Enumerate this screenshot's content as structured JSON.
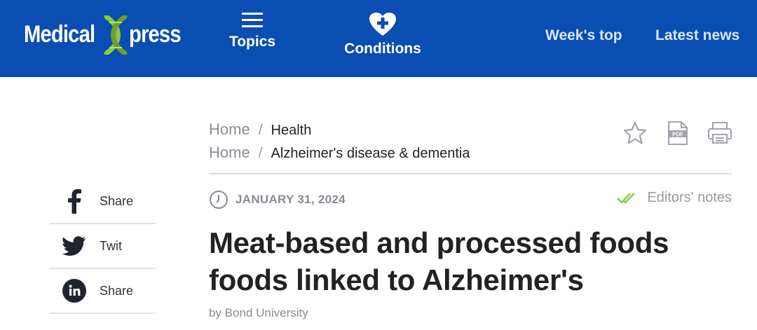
{
  "header": {
    "logo_left": "Medical",
    "logo_right": "press",
    "nav": {
      "topics_label": "Topics",
      "conditions_label": "Conditions",
      "weeks_top_label": "Week's top",
      "latest_news_label": "Latest news"
    },
    "colors": {
      "bar": "#0a4db3",
      "logo_accent": "#8dc63f"
    }
  },
  "breadcrumbs": [
    {
      "home": "Home",
      "separator": "/",
      "category": "Health"
    },
    {
      "home": "Home",
      "separator": "/",
      "category": "Alzheimer's disease & dementia"
    }
  ],
  "tools": {
    "favorite_icon": "star-icon",
    "pdf_icon": "pdf-icon",
    "print_icon": "printer-icon",
    "pdf_text": "PDF"
  },
  "share": [
    {
      "label": "Share",
      "icon": "facebook-icon"
    },
    {
      "label": "Twit",
      "icon": "twitter-icon"
    },
    {
      "label": "Share",
      "icon": "linkedin-icon"
    }
  ],
  "article": {
    "date": "JANUARY 31, 2024",
    "editors_notes": "Editors' notes",
    "title_line1": "Meat-based and processed foods",
    "title_line2": "foods linked to Alzheimer's",
    "byline": "by Bond University"
  }
}
